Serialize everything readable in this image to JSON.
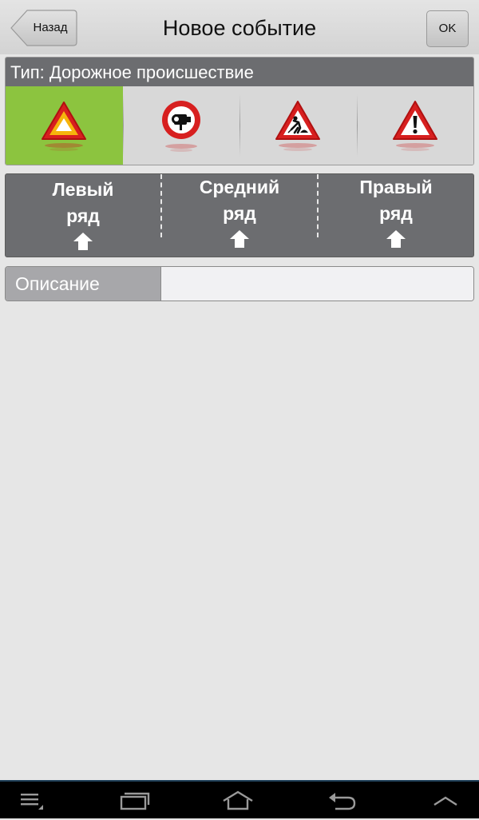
{
  "header": {
    "back_label": "Назад",
    "title": "Новое событие",
    "ok_label": "OK"
  },
  "event_type": {
    "label": "Тип: Дорожное происшествие",
    "selected_index": 0,
    "options": [
      {
        "icon": "accident-warning-triangle-icon"
      },
      {
        "icon": "speed-camera-sign-icon"
      },
      {
        "icon": "road-works-sign-icon"
      },
      {
        "icon": "danger-exclamation-sign-icon"
      }
    ]
  },
  "lanes": [
    {
      "line1": "Левый",
      "line2": "ряд",
      "icon": "arrow-up-icon"
    },
    {
      "line1": "Средний",
      "line2": "ряд",
      "icon": "arrow-up-icon"
    },
    {
      "line1": "Правый",
      "line2": "ряд",
      "icon": "arrow-up-icon"
    }
  ],
  "description": {
    "label": "Описание",
    "value": "",
    "placeholder": ""
  },
  "navbar": {
    "items": [
      "menu-icon",
      "recent-apps-icon",
      "home-icon",
      "back-icon",
      "chevron-up-icon"
    ]
  },
  "colors": {
    "accent_selected": "#8cc43f",
    "section_header": "#6c6d70",
    "background": "#e6e6e6"
  }
}
